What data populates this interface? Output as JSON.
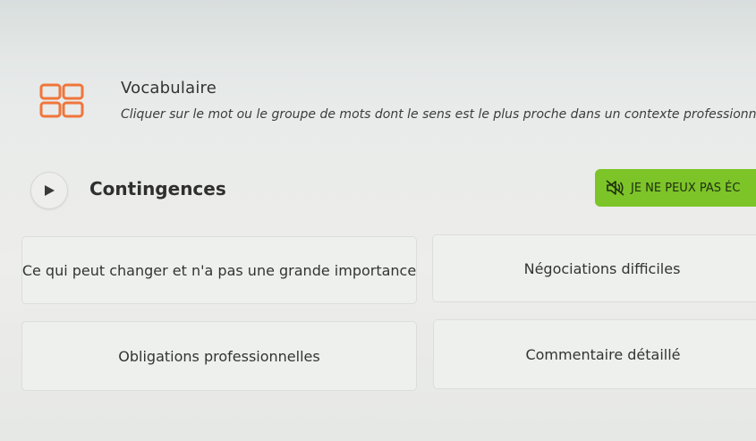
{
  "header": {
    "title": "Vocabulaire",
    "instruction": "Cliquer sur le mot ou le groupe de mots dont le sens est le plus proche dans un contexte professionnel.",
    "icon": "grid-icon",
    "icon_color": "#f0753a"
  },
  "question": {
    "word": "Contingences",
    "play_icon": "play-icon"
  },
  "audio_button": {
    "label": "JE NE PEUX PAS ÉC",
    "icon": "speaker-muted-icon",
    "color": "#7cc428"
  },
  "options": [
    "Ce qui peut changer et n'a pas une grande importance",
    "Négociations difficiles",
    "Obligations professionnelles",
    "Commentaire détaillé"
  ]
}
